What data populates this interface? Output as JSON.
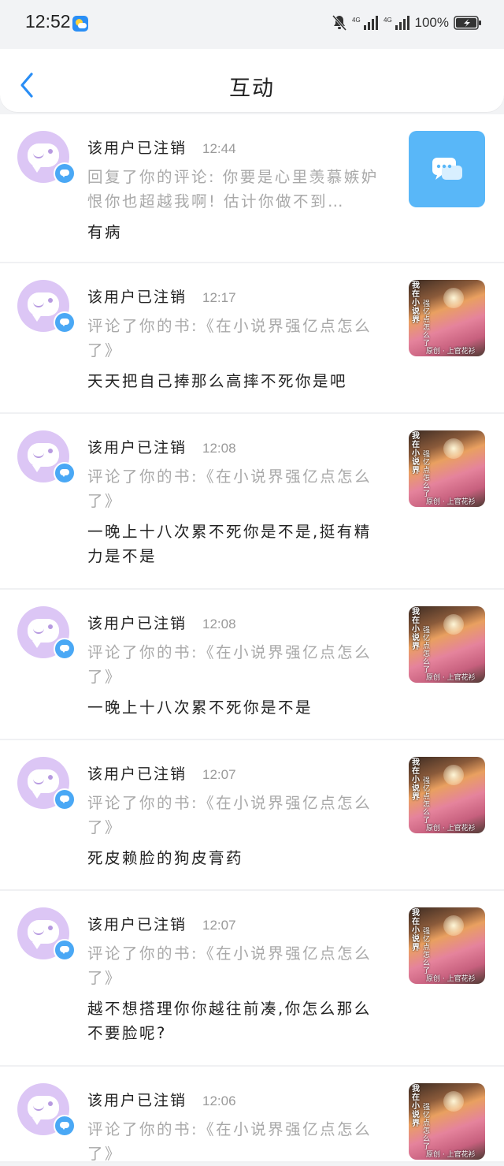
{
  "status_bar": {
    "time": "12:52",
    "network_1": "4G",
    "network_2": "4G",
    "battery": "100%"
  },
  "header": {
    "title": "互动",
    "back_icon": "chevron-left-icon",
    "accent_color": "#2a8ef5"
  },
  "notifications": [
    {
      "username": "该用户已注销",
      "time": "12:44",
      "context": "回复了你的评论: 你要是心里羡慕嫉妒恨你也超越我啊! 估计你做不到…",
      "content": "有病",
      "thumb_type": "chat",
      "thumb_icon": "chat-bubbles-icon"
    },
    {
      "username": "该用户已注销",
      "time": "12:17",
      "context": "评论了你的书:《在小说界强亿点怎么了》",
      "content": "天天把自己捧那么高摔不死你是吧",
      "thumb_type": "book",
      "thumb_caption": "我在小说界",
      "thumb_caption2": "强亿点怎么了",
      "thumb_bottom": "原创 · 上官花衫"
    },
    {
      "username": "该用户已注销",
      "time": "12:08",
      "context": "评论了你的书:《在小说界强亿点怎么了》",
      "content": "一晚上十八次累不死你是不是,挺有精力是不是",
      "thumb_type": "book",
      "thumb_caption": "我在小说界",
      "thumb_caption2": "强亿点怎么了",
      "thumb_bottom": "原创 · 上官花衫"
    },
    {
      "username": "该用户已注销",
      "time": "12:08",
      "context": "评论了你的书:《在小说界强亿点怎么了》",
      "content": "一晚上十八次累不死你是不是",
      "thumb_type": "book",
      "thumb_caption": "我在小说界",
      "thumb_caption2": "强亿点怎么了",
      "thumb_bottom": "原创 · 上官花衫"
    },
    {
      "username": "该用户已注销",
      "time": "12:07",
      "context": "评论了你的书:《在小说界强亿点怎么了》",
      "content": "死皮赖脸的狗皮膏药",
      "thumb_type": "book",
      "thumb_caption": "我在小说界",
      "thumb_caption2": "强亿点怎么了",
      "thumb_bottom": "原创 · 上官花衫"
    },
    {
      "username": "该用户已注销",
      "time": "12:07",
      "context": "评论了你的书:《在小说界强亿点怎么了》",
      "content": "越不想搭理你你越往前凑,你怎么那么不要脸呢?",
      "thumb_type": "book",
      "thumb_caption": "我在小说界",
      "thumb_caption2": "强亿点怎么了",
      "thumb_bottom": "原创 · 上官花衫"
    },
    {
      "username": "该用户已注销",
      "time": "12:06",
      "context": "评论了你的书:《在小说界强亿点怎么了》",
      "content": "",
      "thumb_type": "book",
      "thumb_caption": "我在小说界",
      "thumb_caption2": "强亿点怎么了",
      "thumb_bottom": "原创 · 上官花衫"
    }
  ]
}
